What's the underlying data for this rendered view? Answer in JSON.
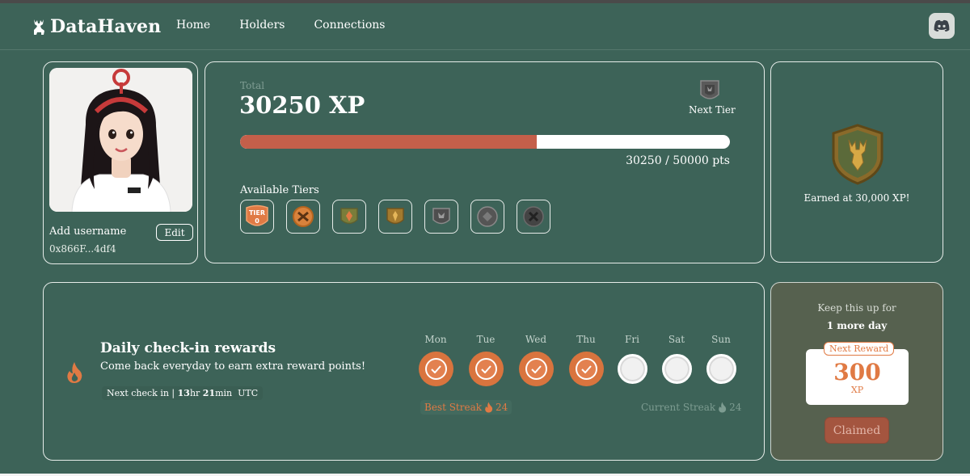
{
  "brand": {
    "name": "DataHaven"
  },
  "nav": {
    "items": [
      "Home",
      "Holders",
      "Connections"
    ]
  },
  "icons": {
    "discord": "discord-icon",
    "fire": "fire-icon",
    "check": "check-icon"
  },
  "colors": {
    "bg": "#3d6358",
    "accent": "#e07a44",
    "progress": "#c45f4a"
  },
  "profile": {
    "username": "Add username",
    "edit_label": "Edit",
    "address": "0x866F...4df4"
  },
  "xp": {
    "total_label": "Total",
    "value": "30250 XP",
    "next_tier_label": "Next Tier",
    "progress_fraction": 0.605,
    "pts_text": "30250 / 50000 pts",
    "available_label": "Available Tiers",
    "tier0_line1": "TIER",
    "tier0_line2": "0"
  },
  "earned": {
    "text": "Earned at 30,000 XP!"
  },
  "checkin": {
    "title": "Daily check-in rewards",
    "subtitle": "Come back everyday to earn extra reward points!",
    "next_prefix": "Next check in | ",
    "next_hr": "13",
    "hr_unit": "hr ",
    "next_min": "21",
    "min_unit": "min",
    "tz": "UTC",
    "days": [
      {
        "name": "Mon",
        "done": true
      },
      {
        "name": "Tue",
        "done": true
      },
      {
        "name": "Wed",
        "done": true
      },
      {
        "name": "Thu",
        "done": true
      },
      {
        "name": "Fri",
        "done": false
      },
      {
        "name": "Sat",
        "done": false
      },
      {
        "name": "Sun",
        "done": false
      }
    ],
    "best_streak_label": "Best Streak",
    "best_streak_value": "24",
    "current_streak_label": "Current Streak",
    "current_streak_value": "24"
  },
  "reward": {
    "keep_text": "Keep this up for",
    "days_text": "1 more day",
    "tag": "Next Reward",
    "amount": "300",
    "unit": "XP",
    "claimed_label": "Claimed"
  }
}
